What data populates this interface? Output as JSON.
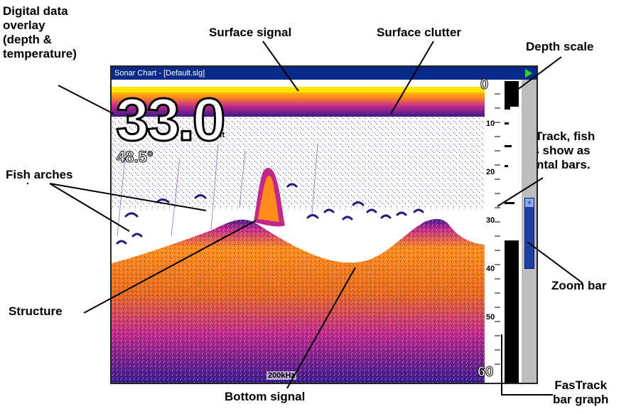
{
  "callouts": {
    "digital_overlay": [
      "Digital data",
      "overlay",
      "(depth &",
      "temperature)"
    ],
    "surface_signal": "Surface signal",
    "surface_clutter": "Surface clutter",
    "depth_scale": "Depth scale",
    "fastrack_fish": [
      "In FasTrack, fish",
      "arches show as",
      "horizontal bars."
    ],
    "fish_arches": "Fish arches",
    "zoom_bar": "Zoom bar",
    "structure": "Structure",
    "bottom_signal": "Bottom signal",
    "fastrack_bar_graph": [
      "FasTrack",
      "bar graph"
    ]
  },
  "window": {
    "title": "Sonar Chart - [Default.slg]"
  },
  "overlay": {
    "depth": "33.0",
    "depth_unit": "ft",
    "temperature": "48.5°"
  },
  "frequency": "200kHz",
  "depth_scale": {
    "top": "0",
    "bottom": "60",
    "marks": [
      "10",
      "20",
      "30",
      "40",
      "50"
    ]
  },
  "zoom_bar_label": "x",
  "colors": {
    "titlebar": "#0a2a8a",
    "surface": "#ffe600",
    "bottom_core": "#ff8c1a",
    "bottom_mid": "#c0288a",
    "bottom_edge": "#3a1a8a",
    "zoom_bar": "#1f3fa8",
    "zoom_track": "#bdbdbd",
    "play_icon": "#2bd62b"
  }
}
